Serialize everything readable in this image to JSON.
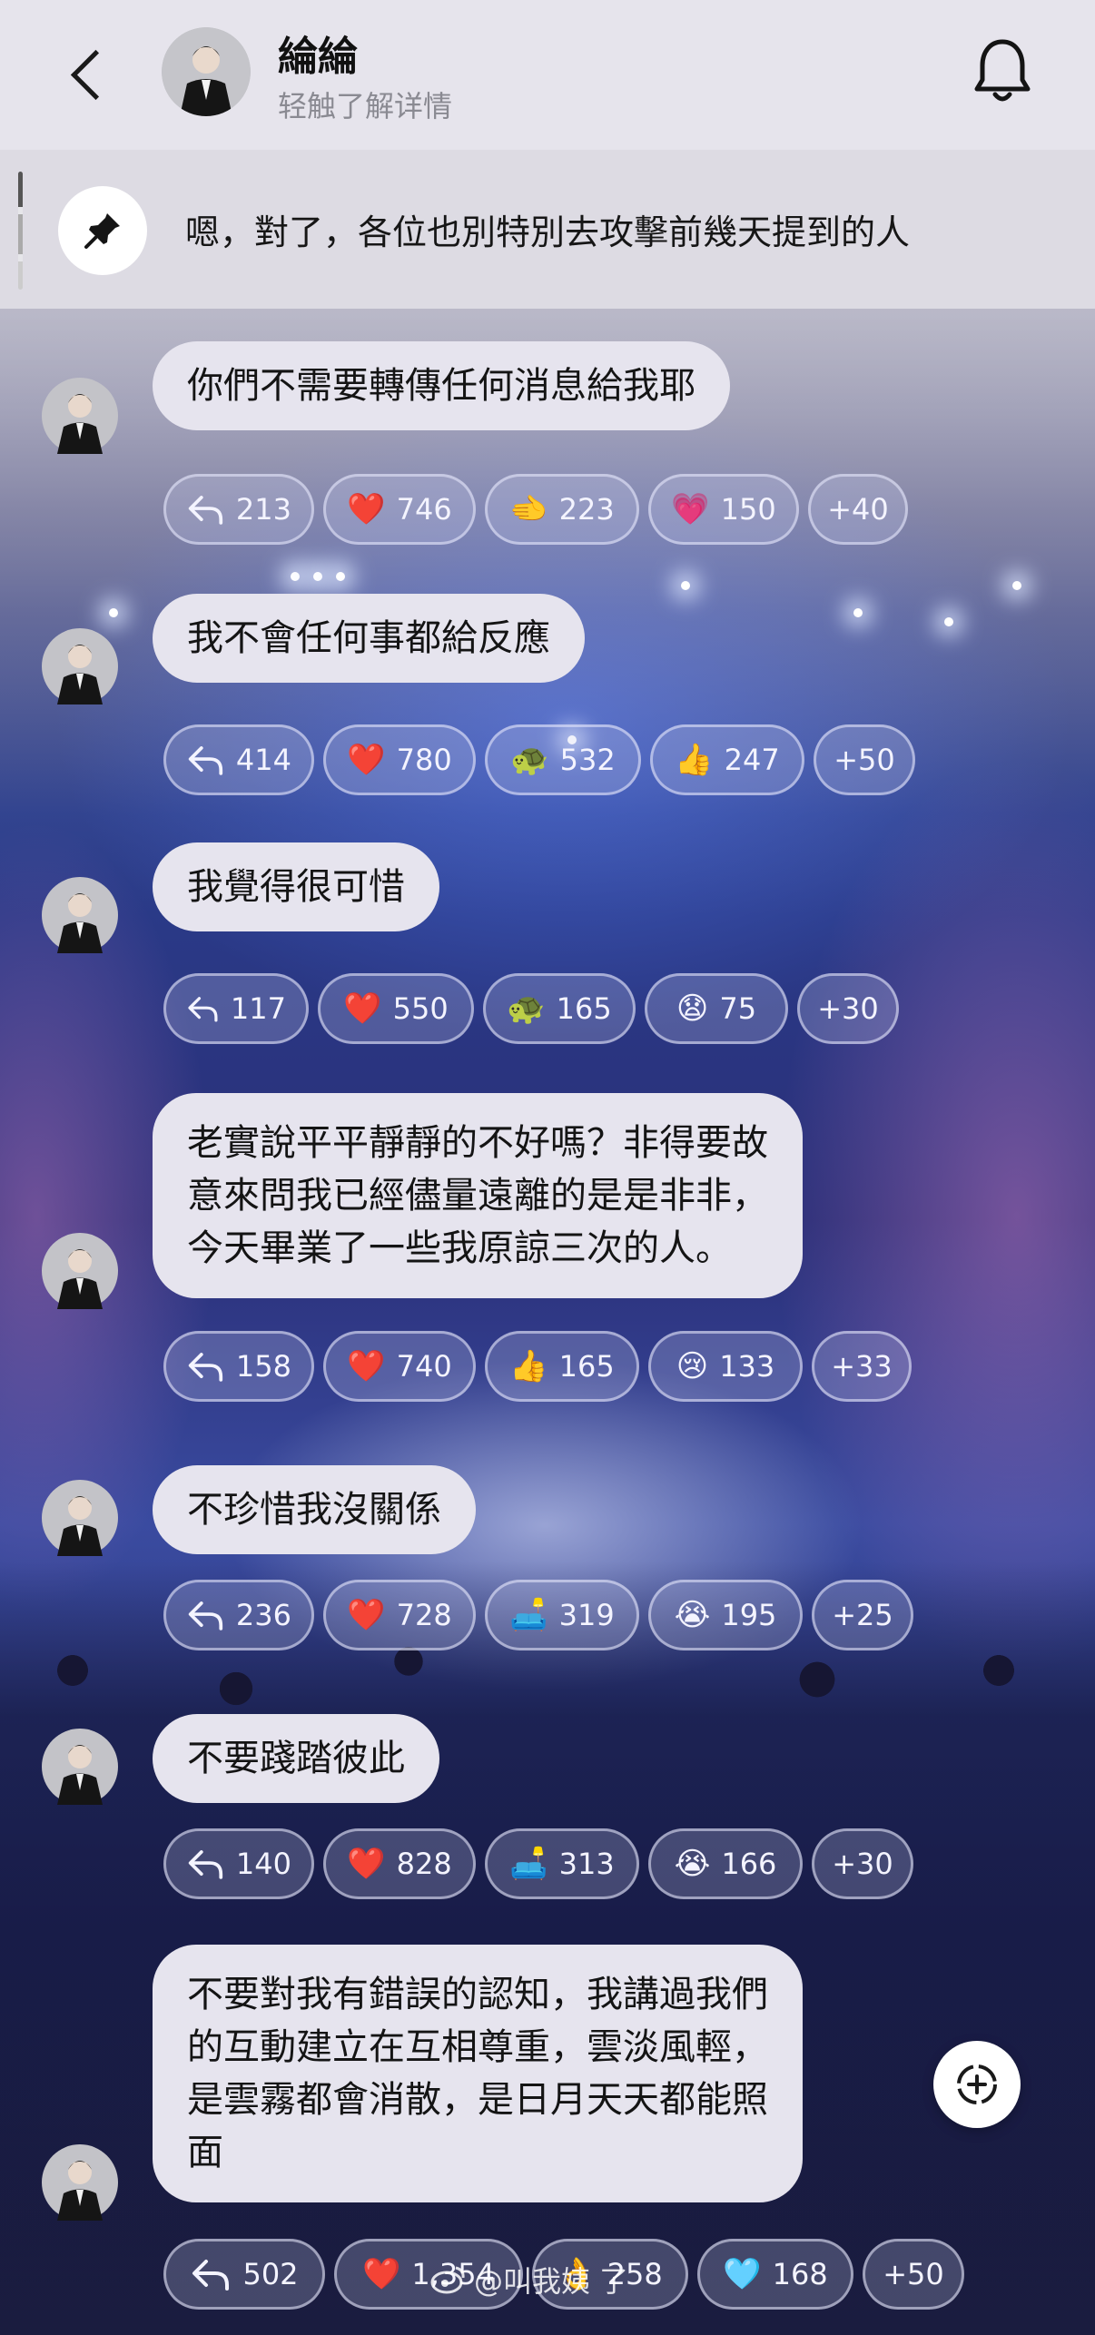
{
  "header": {
    "name": "綸綸",
    "subtitle": "轻触了解详情"
  },
  "pinned": {
    "text": "嗯，對了，各位也別特別去攻擊前幾天提到的人"
  },
  "messages": [
    {
      "lines": [
        "你們不需要轉傳任何消息給我耶"
      ],
      "replies": "213",
      "reactions": [
        {
          "emoji": "❤️",
          "count": "746"
        },
        {
          "emoji": "🫲",
          "count": "223"
        },
        {
          "emoji": "💗",
          "count": "150"
        }
      ],
      "more": "+40"
    },
    {
      "lines": [
        "我不會任何事都給反應"
      ],
      "replies": "414",
      "reactions": [
        {
          "emoji": "❤️",
          "count": "780"
        },
        {
          "emoji": "🐢",
          "count": "532"
        },
        {
          "emoji": "👍",
          "count": "247"
        }
      ],
      "more": "+50"
    },
    {
      "lines": [
        "我覺得很可惜"
      ],
      "replies": "117",
      "reactions": [
        {
          "emoji": "❤️",
          "count": "550"
        },
        {
          "emoji": "🐢",
          "count": "165"
        },
        {
          "emoji": "😧",
          "count": "75"
        }
      ],
      "more": "+30"
    },
    {
      "lines": [
        "老實說平平靜靜的不好嗎？非得要故",
        "意來問我已經儘量遠離的是是非非，",
        "今天畢業了一些我原諒三次的人。"
      ],
      "replies": "158",
      "reactions": [
        {
          "emoji": "❤️",
          "count": "740"
        },
        {
          "emoji": "👍",
          "count": "165"
        },
        {
          "emoji": "😢",
          "count": "133"
        }
      ],
      "more": "+33"
    },
    {
      "lines": [
        "不珍惜我沒關係"
      ],
      "replies": "236",
      "reactions": [
        {
          "emoji": "❤️",
          "count": "728"
        },
        {
          "emoji": "🛋️",
          "count": "319"
        },
        {
          "emoji": "😭",
          "count": "195"
        }
      ],
      "more": "+25"
    },
    {
      "lines": [
        "不要踐踏彼此"
      ],
      "replies": "140",
      "reactions": [
        {
          "emoji": "❤️",
          "count": "828"
        },
        {
          "emoji": "🛋️",
          "count": "313"
        },
        {
          "emoji": "😭",
          "count": "166"
        }
      ],
      "more": "+30"
    },
    {
      "lines": [
        "不要對我有錯誤的認知，我講過我們",
        "的互動建立在互相尊重，雲淡風輕，",
        "是雲霧都會消散，是日月天天都能照",
        "面"
      ],
      "replies": "502",
      "reactions": [
        {
          "emoji": "❤️",
          "count": "1,354"
        },
        {
          "emoji": "👌",
          "count": "258"
        },
        {
          "emoji": "🩵",
          "count": "168"
        }
      ],
      "more": "+50"
    }
  ],
  "watermark": "@叫我姨      了",
  "colors": {
    "header_bg": "#e6e4ec",
    "bubble_bg": "#e6e4ee",
    "chip_text": "#f4f4ff"
  }
}
